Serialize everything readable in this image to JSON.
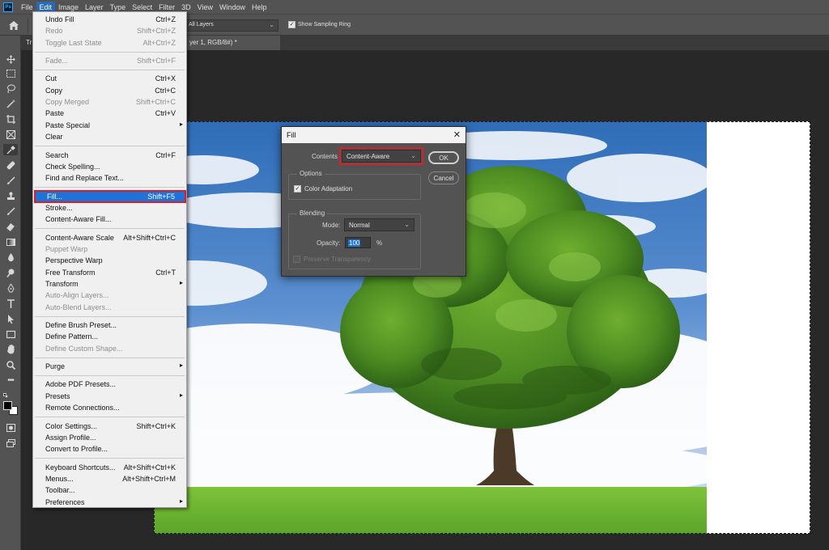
{
  "app": {
    "logo_text": "Ps"
  },
  "menubar": {
    "items": [
      "File",
      "Edit",
      "Image",
      "Layer",
      "Type",
      "Select",
      "Filter",
      "3D",
      "View",
      "Window",
      "Help"
    ]
  },
  "options": {
    "sample_value": "All Layers",
    "show_sampling_ring_label": "Show Sampling Ring"
  },
  "tabs": {
    "partial_left": "Tr",
    "doc_title_partial": "yer 1, RGB/8#) *"
  },
  "edit_menu": {
    "groups": [
      [
        {
          "label": "Undo Fill",
          "shortcut": "Ctrl+Z",
          "enabled": true
        },
        {
          "label": "Redo",
          "shortcut": "Shift+Ctrl+Z",
          "enabled": false
        },
        {
          "label": "Toggle Last State",
          "shortcut": "Alt+Ctrl+Z",
          "enabled": false
        }
      ],
      [
        {
          "label": "Fade...",
          "shortcut": "Shift+Ctrl+F",
          "enabled": false
        }
      ],
      [
        {
          "label": "Cut",
          "shortcut": "Ctrl+X",
          "enabled": true
        },
        {
          "label": "Copy",
          "shortcut": "Ctrl+C",
          "enabled": true
        },
        {
          "label": "Copy Merged",
          "shortcut": "Shift+Ctrl+C",
          "enabled": false
        },
        {
          "label": "Paste",
          "shortcut": "Ctrl+V",
          "enabled": true
        },
        {
          "label": "Paste Special",
          "shortcut": "",
          "enabled": true,
          "submenu": true
        },
        {
          "label": "Clear",
          "shortcut": "",
          "enabled": true
        }
      ],
      [
        {
          "label": "Search",
          "shortcut": "Ctrl+F",
          "enabled": true
        },
        {
          "label": "Check Spelling...",
          "shortcut": "",
          "enabled": true
        },
        {
          "label": "Find and Replace Text...",
          "shortcut": "",
          "enabled": true
        }
      ],
      [
        {
          "label": "Fill...",
          "shortcut": "Shift+F5",
          "enabled": true,
          "highlighted": true
        },
        {
          "label": "Stroke...",
          "shortcut": "",
          "enabled": true
        },
        {
          "label": "Content-Aware Fill...",
          "shortcut": "",
          "enabled": true
        }
      ],
      [
        {
          "label": "Content-Aware Scale",
          "shortcut": "Alt+Shift+Ctrl+C",
          "enabled": true
        },
        {
          "label": "Puppet Warp",
          "shortcut": "",
          "enabled": false
        },
        {
          "label": "Perspective Warp",
          "shortcut": "",
          "enabled": true
        },
        {
          "label": "Free Transform",
          "shortcut": "Ctrl+T",
          "enabled": true
        },
        {
          "label": "Transform",
          "shortcut": "",
          "enabled": true,
          "submenu": true
        },
        {
          "label": "Auto-Align Layers...",
          "shortcut": "",
          "enabled": false
        },
        {
          "label": "Auto-Blend Layers...",
          "shortcut": "",
          "enabled": false
        }
      ],
      [
        {
          "label": "Define Brush Preset...",
          "shortcut": "",
          "enabled": true
        },
        {
          "label": "Define Pattern...",
          "shortcut": "",
          "enabled": true
        },
        {
          "label": "Define Custom Shape...",
          "shortcut": "",
          "enabled": false
        }
      ],
      [
        {
          "label": "Purge",
          "shortcut": "",
          "enabled": true,
          "submenu": true
        }
      ],
      [
        {
          "label": "Adobe PDF Presets...",
          "shortcut": "",
          "enabled": true
        },
        {
          "label": "Presets",
          "shortcut": "",
          "enabled": true,
          "submenu": true
        },
        {
          "label": "Remote Connections...",
          "shortcut": "",
          "enabled": true
        }
      ],
      [
        {
          "label": "Color Settings...",
          "shortcut": "Shift+Ctrl+K",
          "enabled": true
        },
        {
          "label": "Assign Profile...",
          "shortcut": "",
          "enabled": true
        },
        {
          "label": "Convert to Profile...",
          "shortcut": "",
          "enabled": true
        }
      ],
      [
        {
          "label": "Keyboard Shortcuts...",
          "shortcut": "Alt+Shift+Ctrl+K",
          "enabled": true
        },
        {
          "label": "Menus...",
          "shortcut": "Alt+Shift+Ctrl+M",
          "enabled": true
        },
        {
          "label": "Toolbar...",
          "shortcut": "",
          "enabled": true
        },
        {
          "label": "Preferences",
          "shortcut": "",
          "enabled": true,
          "submenu": true
        }
      ]
    ]
  },
  "fill_dialog": {
    "title": "Fill",
    "contents_label": "Contents",
    "contents_value": "Content-Aware",
    "ok_label": "OK",
    "cancel_label": "Cancel",
    "options_title": "Options",
    "color_adaptation_label": "Color Adaptation",
    "color_adaptation_checked": true,
    "blending_title": "Blending",
    "mode_label": "Mode:",
    "mode_value": "Normal",
    "opacity_label": "Opacity:",
    "opacity_value": "100",
    "opacity_unit": "%",
    "preserve_transparency_label": "Preserve Transparency",
    "preserve_transparency_enabled": false
  },
  "colors": {
    "highlight": "#1e72d8",
    "callout_red": "#d8202a",
    "ui_panel": "#535353",
    "workspace": "#282828"
  }
}
